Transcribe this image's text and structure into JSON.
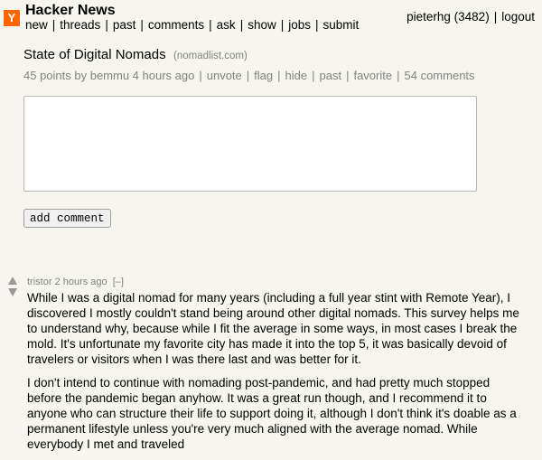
{
  "header": {
    "logo_letter": "Y",
    "site_name": "Hacker News",
    "nav": [
      "new",
      "threads",
      "past",
      "comments",
      "ask",
      "show",
      "jobs",
      "submit"
    ],
    "user": "pieterhg (3482)",
    "logout": "logout"
  },
  "story": {
    "title": "State of Digital Nomads",
    "domain": "(nomadlist.com)",
    "points_by": "45 points by bemmu 4 hours ago",
    "actions": [
      "unvote",
      "flag",
      "hide",
      "past",
      "favorite",
      "54 comments"
    ]
  },
  "form": {
    "add_comment": "add comment"
  },
  "comment": {
    "author": "tristor",
    "age": "2 hours ago",
    "toggle": "[–]",
    "paragraphs": [
      "While I was a digital nomad for many years (including a full year stint with Remote Year), I discovered I mostly couldn't stand being around other digital nomads. This survey helps me to understand why, because while I fit the average in some ways, in most cases I break the mold. It's unfortunate my favorite city has made it into the top 5, it was basically devoid of travelers or visitors when I was there last and was better for it.",
      "I don't intend to continue with nomading post-pandemic, and had pretty much stopped before the pandemic began anyhow. It was a great run though, and I recommend it to anyone who can structure their life to support doing it, although I don't think it's doable as a permanent lifestyle unless you're very much aligned with the average nomad. While everybody I met and traveled"
    ]
  },
  "colors": {
    "background": "#f6f6ef",
    "logo": "#ff6600",
    "subtext": "#828282"
  }
}
